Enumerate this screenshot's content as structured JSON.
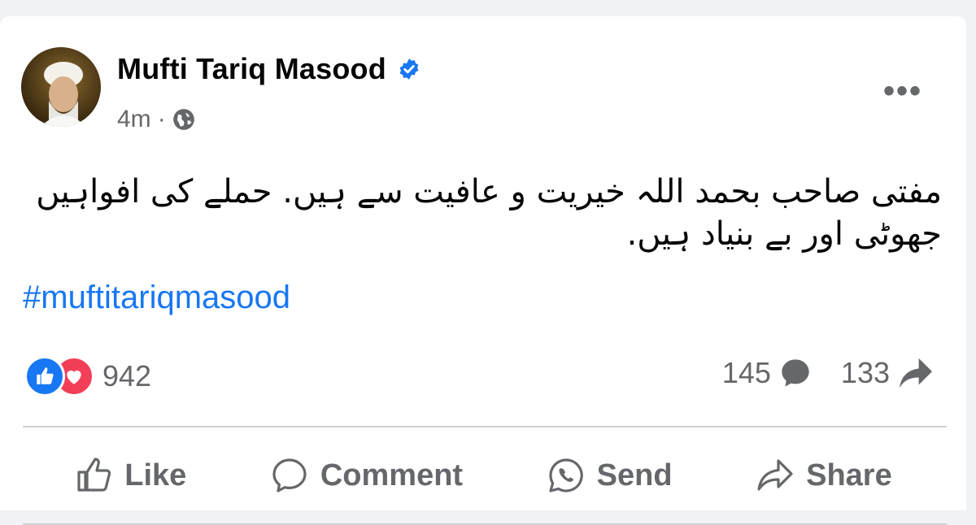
{
  "post": {
    "author": "Mufti Tariq Masood",
    "time": "4m",
    "separator": "·",
    "body": "مفتی صاحب بحمد اللہ خیریت و عافیت سے ہیں. حملے کی افواہیں جھوٹی اور بے بنیاد ہیں.",
    "hashtag": "#muftitariqmasood"
  },
  "engagement": {
    "reactions_count": "942",
    "comments_count": "145",
    "shares_count": "133"
  },
  "actions": {
    "like_label": "Like",
    "comment_label": "Comment",
    "send_label": "Send",
    "share_label": "Share"
  },
  "icons": {
    "verified": "verified-badge-icon",
    "privacy": "globe-icon",
    "more": "more-options-icon",
    "like_reaction": "like-reaction-icon",
    "love_reaction": "love-reaction-icon",
    "comment": "comment-bubble-icon",
    "share": "share-arrow-icon"
  },
  "colors": {
    "brand_blue": "#1877f2",
    "love_red": "#f33e58",
    "secondary_text": "#65676b"
  }
}
